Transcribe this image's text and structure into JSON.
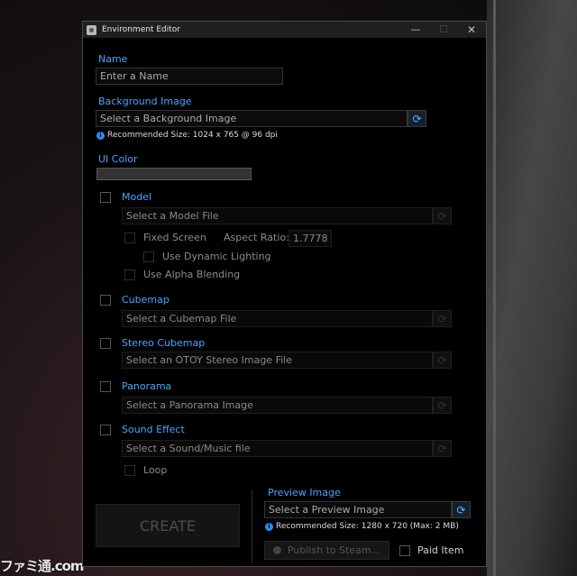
{
  "background": {
    "watermark": "ファミ通.com"
  },
  "window": {
    "title": "Environment Editor",
    "min_glyph": "—",
    "max_glyph": "☐",
    "close_glyph": "✕"
  },
  "name": {
    "label": "Name",
    "placeholder": "Enter a Name"
  },
  "background_image": {
    "label": "Background Image",
    "placeholder": "Select a Background Image",
    "recommended": "Recommended Size: 1024 x 765 @ 96 dpi"
  },
  "ui_color": {
    "label": "UI Color",
    "swatch_color": "#333333"
  },
  "model": {
    "label": "Model",
    "placeholder": "Select a Model File",
    "fixed_screen": "Fixed Screen",
    "aspect_ratio_label": "Aspect Ratio:",
    "aspect_ratio_value": "1.7778",
    "dynamic_lighting": "Use Dynamic Lighting",
    "alpha_blending": "Use Alpha Blending"
  },
  "cubemap": {
    "label": "Cubemap",
    "placeholder": "Select a Cubemap File"
  },
  "stereo_cubemap": {
    "label": "Stereo Cubemap",
    "placeholder": "Select an OTOY Stereo Image File"
  },
  "panorama": {
    "label": "Panorama",
    "placeholder": "Select a Panorama Image"
  },
  "sound_effect": {
    "label": "Sound Effect",
    "placeholder": "Select a Sound/Music file",
    "loop": "Loop"
  },
  "create_label": "CREATE",
  "preview_image": {
    "label": "Preview Image",
    "placeholder": "Select a Preview Image",
    "recommended": "Recommended Size: 1280 x 720 (Max: 2 MB)"
  },
  "publish_label": "Publish to Steam...",
  "paid_item_label": "Paid Item",
  "icons": {
    "picker": "refresh-icon",
    "info": "info-icon",
    "steam": "steam-icon"
  },
  "colors": {
    "accent": "#4aa3ff",
    "window_bg": "#000000"
  }
}
